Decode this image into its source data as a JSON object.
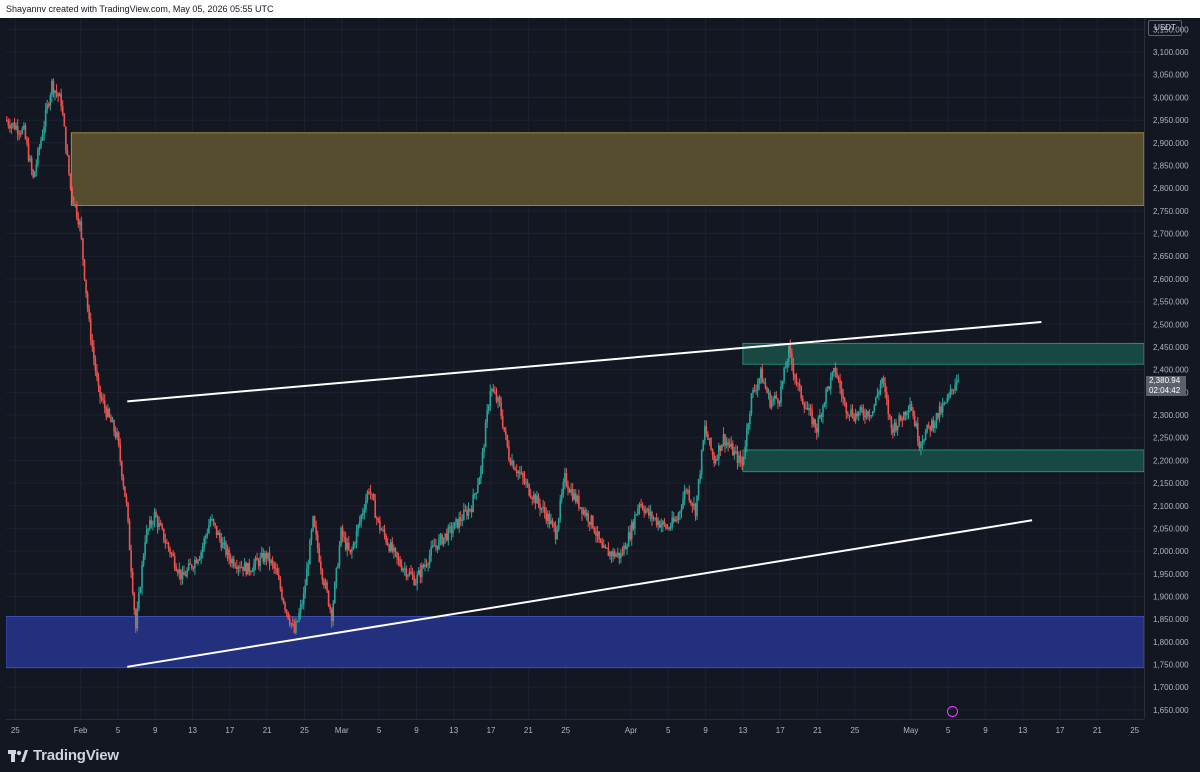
{
  "header": {
    "caption": "Shayannv created with TradingView.com, May 05, 2026 05:55 UTC"
  },
  "footer": {
    "brand": "TradingView"
  },
  "price_axis": {
    "currency": "USDT"
  },
  "last_price": {
    "price": "2,380.94",
    "countdown": "02:04:42"
  },
  "icons": {
    "logo": "tradingview-logo-icon",
    "settings": "chart-settings-icon"
  },
  "chart_data": {
    "type": "candlestick",
    "title": "",
    "xlabel": "",
    "ylabel": "",
    "ylim": [
      1630,
      3175
    ],
    "xlim": [
      "2026-01-24",
      "2026-05-26"
    ],
    "x_tick_labels": [
      "25",
      "Feb",
      "5",
      "9",
      "13",
      "17",
      "21",
      "25",
      "Mar",
      "5",
      "9",
      "13",
      "17",
      "21",
      "25",
      "Apr",
      "5",
      "9",
      "13",
      "17",
      "21",
      "25",
      "May",
      "5",
      "9",
      "13",
      "17",
      "21",
      "25"
    ],
    "y_ticks": [
      1650,
      1700,
      1750,
      1800,
      1850,
      1900,
      1950,
      2000,
      2050,
      2100,
      2150,
      2200,
      2250,
      2300,
      2350,
      2400,
      2450,
      2500,
      2550,
      2600,
      2650,
      2700,
      2750,
      2800,
      2850,
      2900,
      2950,
      3000,
      3050,
      3100,
      3150
    ],
    "colors": {
      "up": "#26a69a",
      "down": "#ef5350",
      "supply_zone": "#b8a43a",
      "demand_zone": "#2b3fa0",
      "flip_zone": "#1a7a68",
      "trendline": "#ffffff"
    },
    "price_path": [
      [
        "2026-01-24",
        2950
      ],
      [
        "2026-01-26",
        2925
      ],
      [
        "2026-01-27",
        2820
      ],
      [
        "2026-01-29",
        3030
      ],
      [
        "2026-01-30",
        2990
      ],
      [
        "2026-01-31",
        2800
      ],
      [
        "2026-02-01",
        2720
      ],
      [
        "2026-02-02",
        2500
      ],
      [
        "2026-02-03",
        2350
      ],
      [
        "2026-02-04",
        2300
      ],
      [
        "2026-02-05",
        2250
      ],
      [
        "2026-02-06",
        2100
      ],
      [
        "2026-02-07",
        1830
      ],
      [
        "2026-02-08",
        2030
      ],
      [
        "2026-02-09",
        2080
      ],
      [
        "2026-02-10",
        2030
      ],
      [
        "2026-02-12",
        1940
      ],
      [
        "2026-02-14",
        2000
      ],
      [
        "2026-02-15",
        2070
      ],
      [
        "2026-02-17",
        1985
      ],
      [
        "2026-02-19",
        1960
      ],
      [
        "2026-02-21",
        1990
      ],
      [
        "2026-02-22",
        1955
      ],
      [
        "2026-02-23",
        1880
      ],
      [
        "2026-02-24",
        1820
      ],
      [
        "2026-02-25",
        1900
      ],
      [
        "2026-02-26",
        2065
      ],
      [
        "2026-02-27",
        1950
      ],
      [
        "2026-02-28",
        1860
      ],
      [
        "2026-03-01",
        2040
      ],
      [
        "2026-03-02",
        1990
      ],
      [
        "2026-03-04",
        2140
      ],
      [
        "2026-03-05",
        2060
      ],
      [
        "2026-03-07",
        1980
      ],
      [
        "2026-03-09",
        1935
      ],
      [
        "2026-03-11",
        2010
      ],
      [
        "2026-03-13",
        2050
      ],
      [
        "2026-03-15",
        2100
      ],
      [
        "2026-03-16",
        2180
      ],
      [
        "2026-03-17",
        2360
      ],
      [
        "2026-03-18",
        2320
      ],
      [
        "2026-03-19",
        2210
      ],
      [
        "2026-03-21",
        2140
      ],
      [
        "2026-03-23",
        2080
      ],
      [
        "2026-03-24",
        2040
      ],
      [
        "2026-03-25",
        2160
      ],
      [
        "2026-03-26",
        2120
      ],
      [
        "2026-03-28",
        2060
      ],
      [
        "2026-03-29",
        2000
      ],
      [
        "2026-03-31",
        1990
      ],
      [
        "2026-04-01",
        2040
      ],
      [
        "2026-04-02",
        2110
      ],
      [
        "2026-04-03",
        2080
      ],
      [
        "2026-04-05",
        2050
      ],
      [
        "2026-04-06",
        2070
      ],
      [
        "2026-04-07",
        2140
      ],
      [
        "2026-04-08",
        2090
      ],
      [
        "2026-04-09",
        2270
      ],
      [
        "2026-04-10",
        2200
      ],
      [
        "2026-04-11",
        2250
      ],
      [
        "2026-04-13",
        2190
      ],
      [
        "2026-04-14",
        2340
      ],
      [
        "2026-04-15",
        2390
      ],
      [
        "2026-04-16",
        2330
      ],
      [
        "2026-04-17",
        2340
      ],
      [
        "2026-04-18",
        2440
      ],
      [
        "2026-04-19",
        2360
      ],
      [
        "2026-04-20",
        2310
      ],
      [
        "2026-04-21",
        2270
      ],
      [
        "2026-04-22",
        2350
      ],
      [
        "2026-04-23",
        2400
      ],
      [
        "2026-04-24",
        2320
      ],
      [
        "2026-04-25",
        2300
      ],
      [
        "2026-04-27",
        2310
      ],
      [
        "2026-04-28",
        2380
      ],
      [
        "2026-04-29",
        2270
      ],
      [
        "2026-04-30",
        2290
      ],
      [
        "2026-05-01",
        2330
      ],
      [
        "2026-05-02",
        2240
      ],
      [
        "2026-05-03",
        2270
      ],
      [
        "2026-05-04",
        2300
      ],
      [
        "2026-05-05",
        2330
      ],
      [
        "2026-05-06",
        2381
      ]
    ],
    "zones": [
      {
        "name": "supply",
        "from": "2026-01-31",
        "to": "2026-05-26",
        "low": 2762,
        "high": 2922
      },
      {
        "name": "demand",
        "from": "2026-01-24",
        "to": "2026-05-26",
        "low": 1743,
        "high": 1856
      },
      {
        "name": "resistance",
        "from": "2026-04-13",
        "to": "2026-05-26",
        "low": 2412,
        "high": 2458
      },
      {
        "name": "support",
        "from": "2026-04-13",
        "to": "2026-05-26",
        "low": 2175,
        "high": 2223
      }
    ],
    "trendlines": [
      {
        "name": "channel-top",
        "from": [
          "2026-02-06",
          2330
        ],
        "to": [
          "2026-05-15",
          2505
        ]
      },
      {
        "name": "channel-bottom",
        "from": [
          "2026-02-06",
          1745
        ],
        "to": [
          "2026-05-14",
          2068
        ]
      }
    ]
  }
}
